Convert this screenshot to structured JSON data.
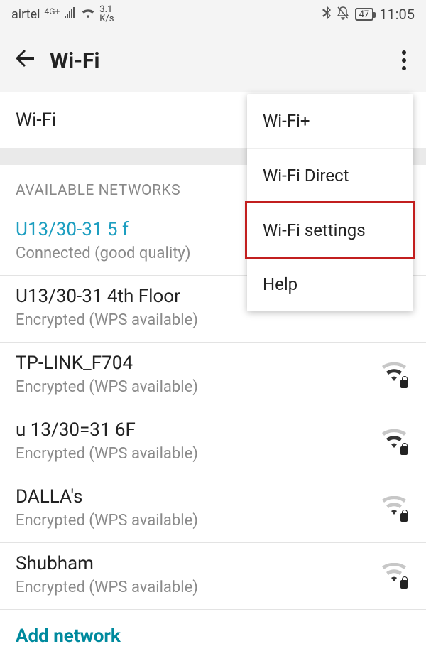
{
  "status": {
    "carrier": "airtel",
    "net_label": "4G+",
    "speed_top": "3.1",
    "speed_bottom": "K/s",
    "battery": "47",
    "time": "11:05"
  },
  "header": {
    "title": "Wi-Fi"
  },
  "toggle_row": {
    "label": "Wi-Fi"
  },
  "section": {
    "title": "AVAILABLE NETWORKS"
  },
  "networks": [
    {
      "ssid": "U13/30-31 5 f",
      "sub": "Connected (good quality)",
      "connected": true,
      "show_icon": false
    },
    {
      "ssid": "U13/30-31 4th Floor",
      "sub": "Encrypted (WPS available)",
      "connected": false,
      "show_icon": false
    },
    {
      "ssid": "TP-LINK_F704",
      "sub": "Encrypted (WPS available)",
      "connected": false,
      "show_icon": true,
      "strength": 2
    },
    {
      "ssid": "u 13/30=31 6F",
      "sub": "Encrypted (WPS available)",
      "connected": false,
      "show_icon": true,
      "strength": 2
    },
    {
      "ssid": "DALLA's",
      "sub": "Encrypted (WPS available)",
      "connected": false,
      "show_icon": true,
      "strength": 1
    },
    {
      "ssid": "Shubham",
      "sub": "Encrypted (WPS available)",
      "connected": false,
      "show_icon": true,
      "strength": 1
    }
  ],
  "add_network_label": "Add network",
  "popup": {
    "items": [
      {
        "label": "Wi-Fi+",
        "highlighted": false
      },
      {
        "label": "Wi-Fi Direct",
        "highlighted": false
      },
      {
        "label": "Wi-Fi settings",
        "highlighted": true
      },
      {
        "label": "Help",
        "highlighted": false
      }
    ]
  }
}
